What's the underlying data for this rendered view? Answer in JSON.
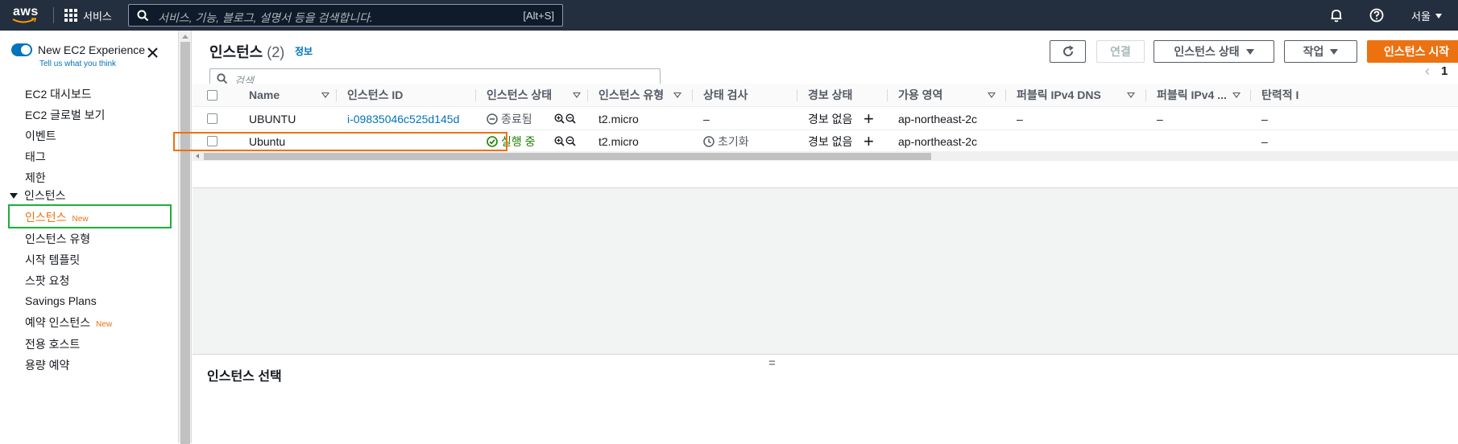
{
  "topnav": {
    "logo": "aws",
    "services_label": "서비스",
    "search_placeholder": "서비스, 기능, 블로그, 설명서 등을 검색합니다.",
    "search_shortcut": "[Alt+S]",
    "region_label": "서울"
  },
  "sidebar": {
    "new_experience_label": "New EC2 Experience",
    "tell_us_label": "Tell us what you think",
    "top_items": [
      "EC2 대시보드",
      "EC2 글로벌 보기",
      "이벤트",
      "태그",
      "제한"
    ],
    "section_label": "인스턴스",
    "section_items": [
      {
        "label": "인스턴스",
        "badge": "New"
      },
      {
        "label": "인스턴스 유형",
        "badge": ""
      },
      {
        "label": "시작 템플릿",
        "badge": ""
      },
      {
        "label": "스팟 요청",
        "badge": ""
      },
      {
        "label": "Savings Plans",
        "badge": ""
      },
      {
        "label": "예약 인스턴스",
        "badge": "New"
      },
      {
        "label": "전용 호스트",
        "badge": ""
      },
      {
        "label": "용량 예약",
        "badge": ""
      }
    ]
  },
  "header": {
    "title": "인스턴스",
    "count": "(2)",
    "info_link": "정보",
    "connect_button": "연결",
    "instance_state_button": "인스턴스 상태",
    "actions_button": "작업",
    "launch_button": "인스턴스 시작",
    "filter_placeholder": "검색",
    "page_number": "1"
  },
  "table": {
    "columns": [
      "Name",
      "인스턴스 ID",
      "인스턴스 상태",
      "인스턴스 유형",
      "상태 검사",
      "경보 상태",
      "가용 영역",
      "퍼블릭 IPv4 DNS",
      "퍼블릭 IPv4 ...",
      "탄력적 I"
    ],
    "rows": [
      {
        "name": "UBUNTU",
        "instance_id": "i-09835046c525d145d",
        "state": "종료됨",
        "type": "t2.micro",
        "status_check": "–",
        "alarm": "경보 없음",
        "zone": "ap-northeast-2c",
        "dns": "–",
        "ipv4": "–",
        "elastic": "–"
      },
      {
        "name": "Ubuntu",
        "instance_id": "",
        "state": "실행 중",
        "type": "t2.micro",
        "status_check": "초기화",
        "alarm": "경보 없음",
        "zone": "ap-northeast-2c",
        "dns": "",
        "ipv4": "",
        "elastic": "–"
      }
    ]
  },
  "bottom_panel": {
    "handle": "=",
    "title": "인스턴스 선택"
  },
  "colors": {
    "nav_bg": "#232f3e",
    "accent_orange": "#ec7211",
    "link_blue": "#0073bb",
    "running_green": "#1d8102",
    "highlight_green": "#1fad3a"
  }
}
